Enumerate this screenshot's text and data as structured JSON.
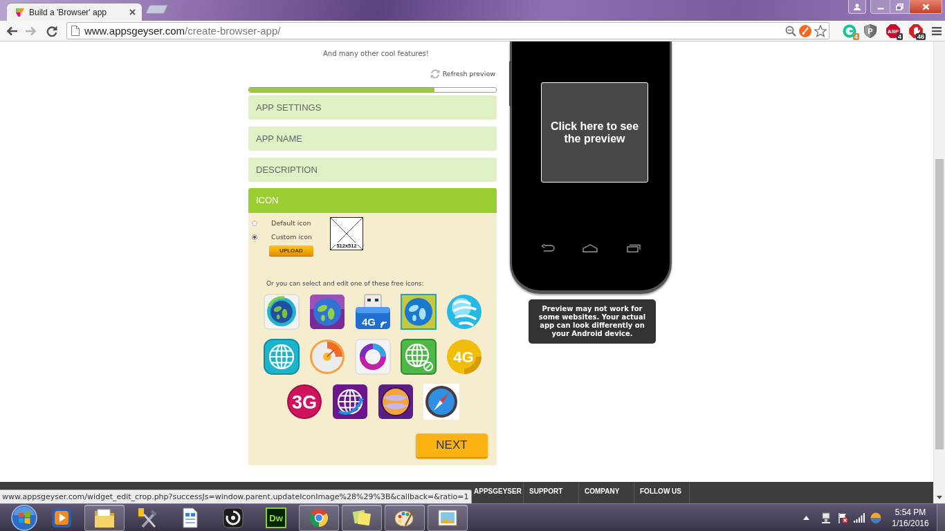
{
  "browser": {
    "tabs": [
      {
        "title": "Build a 'Browser' app",
        "selected": true
      }
    ],
    "nav": {
      "back_enabled": true,
      "forward_enabled": false
    },
    "url": {
      "host": "www.appsgeyser.com",
      "path": "/create-browser-app/"
    },
    "extensions": [
      {
        "kind": "green-ring",
        "badge": "4"
      },
      {
        "kind": "shield",
        "label": "P"
      },
      {
        "kind": "abp",
        "label": "ABP",
        "badge": "4"
      },
      {
        "kind": "stop-hand",
        "badge": "46"
      }
    ]
  },
  "page": {
    "features_note": "And many other cool features!",
    "refresh_link": "Refresh preview",
    "progress": {
      "level": 0.75
    },
    "sections": [
      {
        "title": "APP SETTINGS",
        "expanded": false
      },
      {
        "title": "APP NAME",
        "expanded": false
      },
      {
        "title": "DESCRIPTION",
        "expanded": false
      },
      {
        "title": "ICON",
        "expanded": true
      }
    ],
    "icon_panel": {
      "options": [
        {
          "label": "Default icon",
          "selected": false
        },
        {
          "label": "Custom icon",
          "selected": true
        }
      ],
      "upload_button": "UPLOAD",
      "placeholder_size": "512x512",
      "prompt": "Or you can select and edit one of these free icons:",
      "free_icons": [
        {
          "kind": "globe-tile"
        },
        {
          "kind": "globe-square"
        },
        {
          "kind": "usb-4g",
          "label": "4G"
        },
        {
          "kind": "globe-framed"
        },
        {
          "kind": "swirl-ball"
        },
        {
          "kind": "grid-globe-tile"
        },
        {
          "kind": "gauge"
        },
        {
          "kind": "ring"
        },
        {
          "kind": "grid-globe-badge"
        },
        {
          "kind": "network-4g",
          "label": "4G"
        },
        {
          "kind": "network-3g",
          "label": "3G"
        },
        {
          "kind": "grid-globe-arrow"
        },
        {
          "kind": "mosaic-ball"
        },
        {
          "kind": "compass"
        }
      ],
      "next_button": "NEXT"
    },
    "preview": {
      "button": "Click here to see the preview",
      "note": "Preview may not work for some websites. Your actual app can look differently on your Android device."
    },
    "footer": {
      "headings": [
        "APPSGEYSER",
        "SUPPORT",
        "COMPANY",
        "FOLLOW US"
      ]
    }
  },
  "status_bubble": "www.appsgeyser.com/widget_edit_crop.php?successJs=window.parent.updateIconImage%28%29%3B&callback=&ratio=1",
  "taskbar": {
    "apps": [
      {
        "kind": "media-player",
        "open": false
      },
      {
        "kind": "file-explorer",
        "open": true
      },
      {
        "kind": "tools",
        "open": false
      },
      {
        "kind": "document",
        "open": false
      },
      {
        "kind": "modeler",
        "open": false
      },
      {
        "kind": "dreamweaver",
        "label": "Dw",
        "open": false
      },
      {
        "kind": "chrome",
        "open": true
      },
      {
        "kind": "sticky-notes",
        "open": true
      },
      {
        "kind": "paint",
        "open": true
      },
      {
        "kind": "photo-viewer",
        "open": true
      }
    ],
    "clock": {
      "time": "5:54 PM",
      "date": "1/16/2016"
    }
  }
}
